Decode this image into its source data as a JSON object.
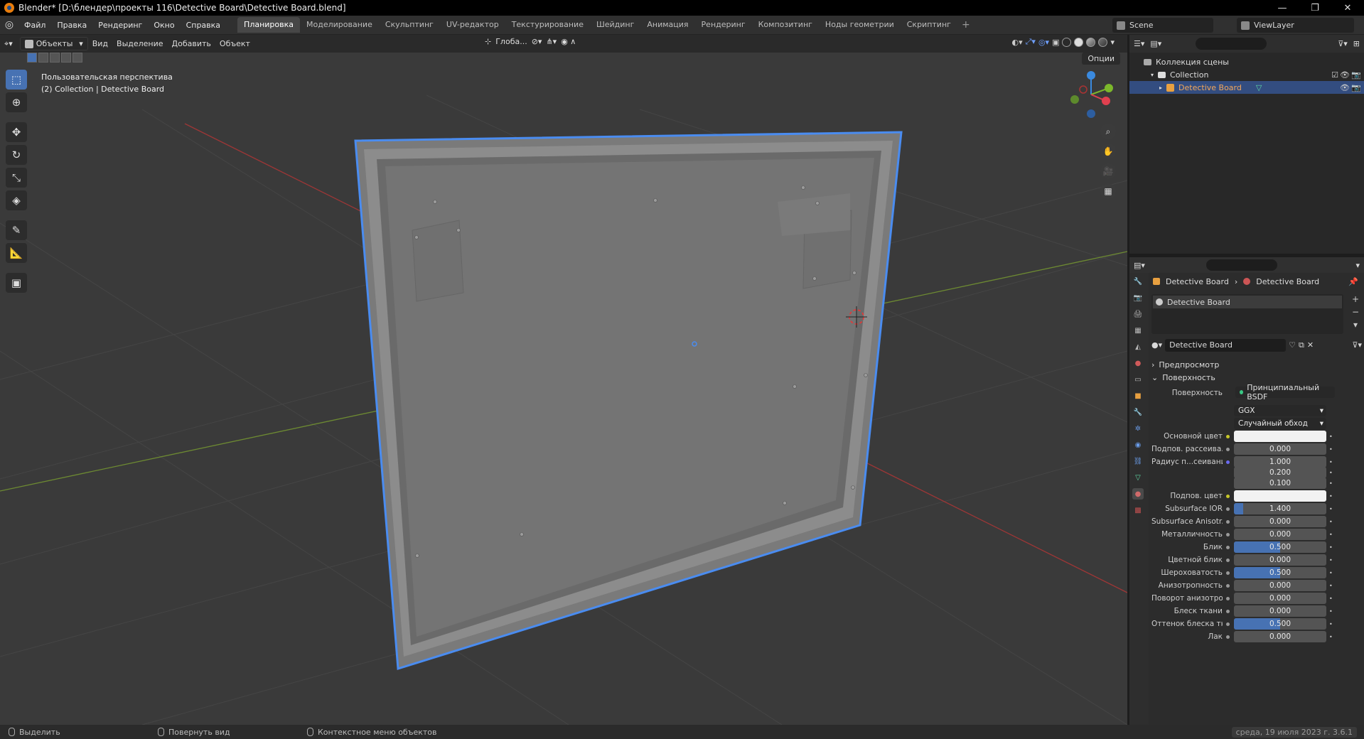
{
  "title_bar": {
    "title": "Blender* [D:\\блендер\\проекты 116\\Detective Board\\Detective Board.blend]",
    "minimize": "—",
    "restore": "❐",
    "close": "✕"
  },
  "menu": {
    "items": [
      "Файл",
      "Правка",
      "Рендеринг",
      "Окно",
      "Справка"
    ],
    "workspaces": [
      "Планировка",
      "Моделирование",
      "Скульптинг",
      "UV-редактор",
      "Текстурирование",
      "Шейдинг",
      "Анимация",
      "Рендеринг",
      "Композитинг",
      "Ноды геометрии",
      "Скриптинг"
    ],
    "active_workspace": "Планировка",
    "add_workspace": "+",
    "scene": "Scene",
    "view_layer": "ViewLayer"
  },
  "viewport_header": {
    "mode": "Объекты",
    "menus": [
      "Вид",
      "Выделение",
      "Добавить",
      "Объект"
    ],
    "orientation": "Глоба...",
    "options": "Опции"
  },
  "viewport": {
    "view_name": "Пользовательская перспектива",
    "collection_info": "(2) Collection | Detective Board"
  },
  "toolbar_icons": [
    "select-box-icon",
    "cursor-icon",
    "move-icon",
    "rotate-icon",
    "scale-icon",
    "transform-icon",
    "annotate-icon",
    "measure-icon",
    "add-cube-icon"
  ],
  "outliner": {
    "scene_collection": "Коллекция сцены",
    "collection": "Collection",
    "object": "Detective Board"
  },
  "properties": {
    "breadcrumb_object": "Detective Board",
    "breadcrumb_material": "Detective Board",
    "slot_name": "Detective Board",
    "material_name": "Detective Board",
    "preview_panel": "Предпросмотр",
    "surface_panel": "Поверхность",
    "surface_label": "Поверхность",
    "surface_shader": "Принципиальный BSDF",
    "distribution": "GGX",
    "subsurface_method": "Случайный обход",
    "rows": [
      {
        "label": "Основной цвет",
        "value": "",
        "kind": "color",
        "dot": "yellow"
      },
      {
        "label": "Подпов. рассеива...",
        "value": "0.000",
        "kind": "number",
        "dot": "grey"
      },
      {
        "label": "Радиус п...сеивания",
        "value": "1.000",
        "kind": "number",
        "dot": "blue"
      },
      {
        "label": "",
        "value": "0.200",
        "kind": "number",
        "dot": "none"
      },
      {
        "label": "",
        "value": "0.100",
        "kind": "number",
        "dot": "none"
      },
      {
        "label": "Подпов. цвет",
        "value": "",
        "kind": "color",
        "dot": "yellow"
      },
      {
        "label": "Subsurface IOR",
        "value": "1.400",
        "kind": "number",
        "dot": "grey",
        "fill": 0.1
      },
      {
        "label": "Subsurface Anisotr...",
        "value": "0.000",
        "kind": "number",
        "dot": "grey"
      },
      {
        "label": "Металличность",
        "value": "0.000",
        "kind": "number",
        "dot": "grey"
      },
      {
        "label": "Блик",
        "value": "0.500",
        "kind": "number",
        "dot": "grey",
        "fill": 0.5
      },
      {
        "label": "Цветной блик",
        "value": "0.000",
        "kind": "number",
        "dot": "grey"
      },
      {
        "label": "Шероховатость",
        "value": "0.500",
        "kind": "number",
        "dot": "grey",
        "fill": 0.5
      },
      {
        "label": "Анизотропность",
        "value": "0.000",
        "kind": "number",
        "dot": "grey"
      },
      {
        "label": "Поворот анизотро...",
        "value": "0.000",
        "kind": "number",
        "dot": "grey"
      },
      {
        "label": "Блеск ткани",
        "value": "0.000",
        "kind": "number",
        "dot": "grey"
      },
      {
        "label": "Оттенок блеска тк...",
        "value": "0.500",
        "kind": "number",
        "dot": "grey",
        "fill": 0.5
      },
      {
        "label": "Лак",
        "value": "0.000",
        "kind": "number",
        "dot": "grey"
      }
    ]
  },
  "status_bar": {
    "select": "Выделить",
    "rotate_view": "Повернуть вид",
    "context_menu": "Контекстное меню объектов",
    "date": "среда, 19 июля 2023 г. 3.6.1"
  },
  "colors": {
    "accent": "#4772b3",
    "selection_outline": "#4a8cf0",
    "x_axis": "#c23a3a",
    "y_axis": "#7aa82b"
  }
}
